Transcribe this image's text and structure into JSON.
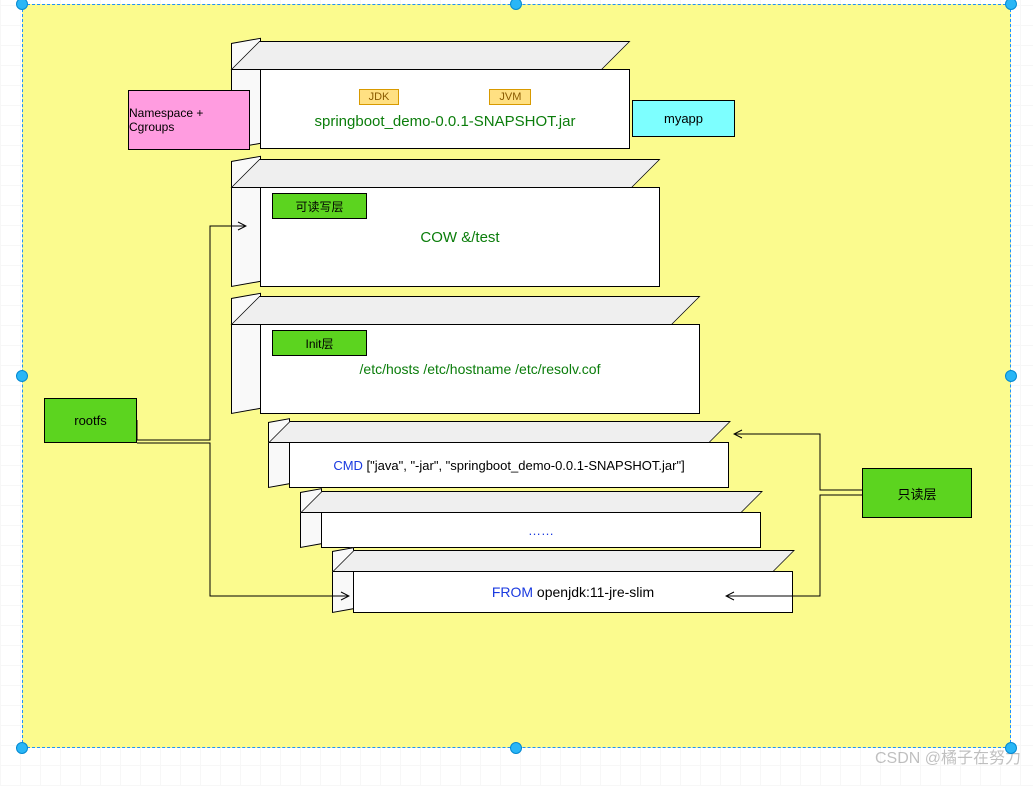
{
  "watermark": "CSDN @橘子在努力",
  "labels": {
    "namespace": "Namespace + Cgroups",
    "myapp": "myapp",
    "rootfs": "rootfs",
    "readonly": "只读层"
  },
  "layers": {
    "top": {
      "jdk": "JDK",
      "jvm": "JVM",
      "text": "springboot_demo-0.0.1-SNAPSHOT.jar"
    },
    "rw": {
      "tab": "可读写层",
      "text": "COW  &/test"
    },
    "init": {
      "tab": "Init层",
      "text": "/etc/hosts  /etc/hostname  /etc/resolv.cof"
    },
    "cmd": {
      "kw": "CMD",
      "rest": " [\"java\", \"-jar\", \"springboot_demo-0.0.1-SNAPSHOT.jar\"]"
    },
    "dots": "……",
    "from": {
      "kw": "FROM",
      "rest": " openjdk:11-jre-slim"
    }
  }
}
